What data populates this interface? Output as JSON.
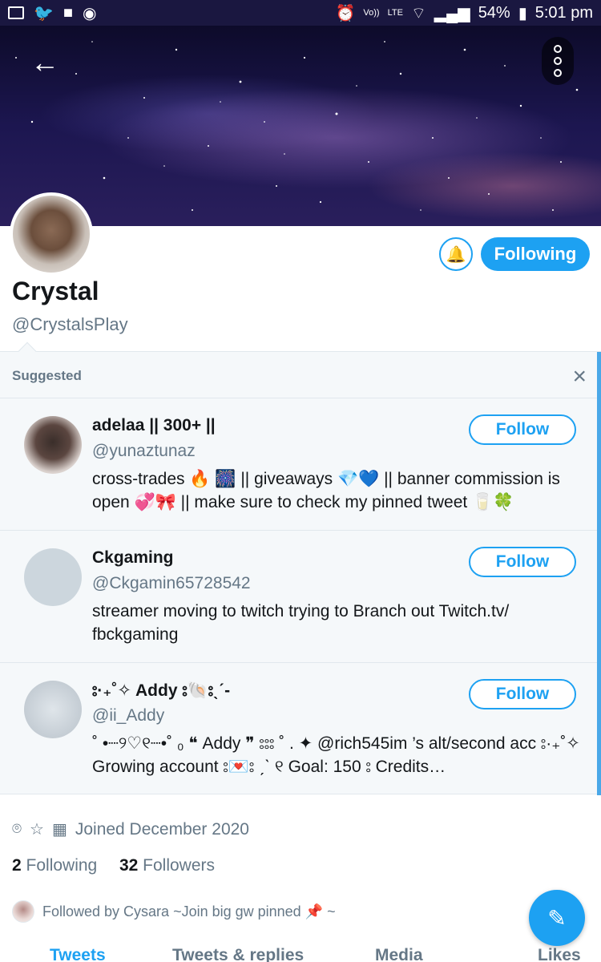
{
  "status_bar": {
    "battery": "54%",
    "time": "5:01 pm",
    "network": "LTE",
    "volte": "Vo))"
  },
  "profile": {
    "display_name": "Crystal",
    "handle": "@CrystalsPlay",
    "following_button": "Following",
    "joined": "Joined December 2020",
    "following_count": "2",
    "following_label": "Following",
    "followers_count": "32",
    "followers_label": "Followers",
    "followed_by": "Followed by Cysara ~Join big gw pinned 📌 ~"
  },
  "suggested": {
    "title": "Suggested",
    "close_icon": "×",
    "accounts": [
      {
        "name": "adelaa || 300+ ||",
        "handle": "@yunaztunaz",
        "bio": "cross-trades 🔥 🎆 || giveaways 💎💙 || banner commission is open 💞🎀 || make sure to check my pinned tweet 🥛🍀",
        "follow_label": "Follow"
      },
      {
        "name": "Ckgaming",
        "handle": "@Ckgamin65728542",
        "bio": "streamer moving to twitch trying to  Branch out  Twitch.tv/ fbckgaming",
        "follow_label": "Follow"
      },
      {
        "name": "⦂·₊˚✧ Addy ⦂🐚⦂ˎˊ-",
        "handle": "@ii_Addy",
        "bio": "˚ •┈୨♡୧┈•˚ ₀ ❝ Addy ❞ ⦂⦂⦂ ˚ . ✦ @rich545im ’s alt/second acc ⦂·₊˚✧ Growing account ⦂💌⦂ ˏˋ ୧ Goal: 150 ⦂ Credits…",
        "follow_label": "Follow"
      }
    ]
  },
  "tabs": [
    "Tweets",
    "Tweets & replies",
    "Media",
    "Likes"
  ],
  "colors": {
    "accent": "#1da1f2",
    "muted": "#657786",
    "text": "#14171a"
  }
}
